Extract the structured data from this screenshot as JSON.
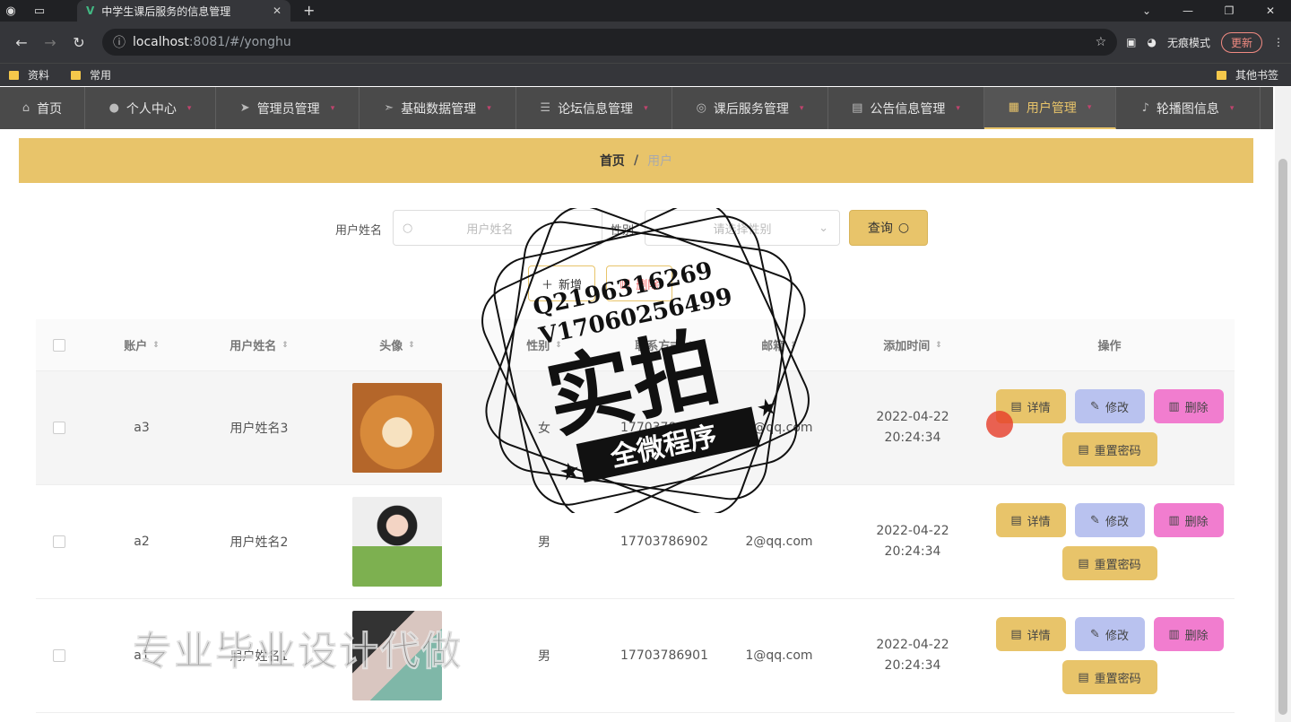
{
  "browser": {
    "tab_title": "中学生课后服务的信息管理",
    "url_host": "localhost",
    "url_rest": ":8081/#/yonghu",
    "incognito_label": "无痕模式",
    "update_label": "更新",
    "bookmarks": [
      "资料",
      "常用"
    ],
    "other_bookmarks": "其他书签"
  },
  "menu": [
    {
      "label": "首页",
      "icon": "home-icon"
    },
    {
      "label": "个人中心",
      "icon": "user-icon"
    },
    {
      "label": "管理员管理",
      "icon": "send-icon"
    },
    {
      "label": "基础数据管理",
      "icon": "send-icon"
    },
    {
      "label": "论坛信息管理",
      "icon": "list-icon"
    },
    {
      "label": "课后服务管理",
      "icon": "compass-icon"
    },
    {
      "label": "公告信息管理",
      "icon": "message-icon"
    },
    {
      "label": "用户管理",
      "icon": "chart-icon",
      "active": true
    },
    {
      "label": "轮播图信息",
      "icon": "mic-icon"
    }
  ],
  "breadcrumb": {
    "home": "首页",
    "sep": "/",
    "current": "用户"
  },
  "search": {
    "name_label": "用户姓名",
    "name_placeholder": "用户姓名",
    "gender_label": "性别",
    "gender_placeholder": "请选择性别",
    "query_label": "查询"
  },
  "actions": {
    "add": "新增",
    "delete": "删除"
  },
  "table": {
    "headers": [
      "账户",
      "用户姓名",
      "头像",
      "性别",
      "联系方式",
      "邮箱",
      "添加时间",
      "操作"
    ],
    "rows": [
      {
        "account": "a3",
        "name": "用户姓名3",
        "gender": "女",
        "phone": "17703786903",
        "email": "3@qq.com",
        "time": "2022-04-22 20:24:34"
      },
      {
        "account": "a2",
        "name": "用户姓名2",
        "gender": "男",
        "phone": "17703786902",
        "email": "2@qq.com",
        "time": "2022-04-22 20:24:34"
      },
      {
        "account": "a1",
        "name": "用户姓名1",
        "gender": "男",
        "phone": "17703786901",
        "email": "1@qq.com",
        "time": "2022-04-22 20:24:34"
      }
    ],
    "ops": {
      "detail": "详情",
      "edit": "修改",
      "delete": "删除",
      "reset": "重置密码"
    }
  },
  "watermark": {
    "line1": "Q2196316269",
    "line2": "V17060256499",
    "big": "实拍",
    "ribbon": "全微程序",
    "footer": "专业毕业设计代做"
  }
}
